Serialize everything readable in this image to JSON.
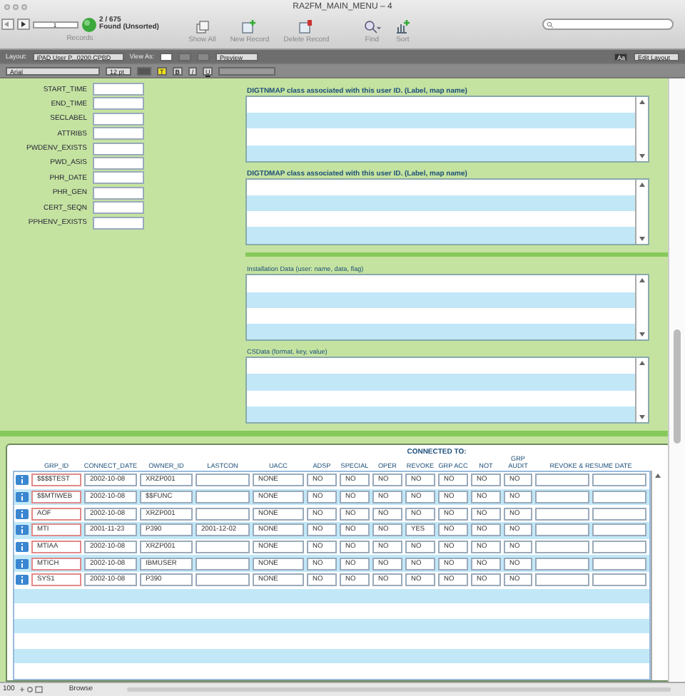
{
  "window": {
    "title": "RA2FM_MAIN_MENU – 4"
  },
  "toolbar": {
    "record": "1",
    "count": "2 / 675",
    "found": "Found (Unsorted)",
    "records_label": "Records",
    "buttons": [
      {
        "kind": "show_all",
        "label": "Show All"
      },
      {
        "kind": "new",
        "label": "New Record"
      },
      {
        "kind": "delete",
        "label": "Delete Record"
      },
      {
        "kind": "find",
        "label": "Find"
      },
      {
        "kind": "sort",
        "label": "Sort"
      }
    ]
  },
  "layout_bar": {
    "layout_label": "Layout:",
    "layout": "iPAD User P...0200.CPBD",
    "view_as": "View As:",
    "preview": "Preview",
    "aa": "Aa",
    "edit_layout": "Edit Layout"
  },
  "format_bar": {
    "font": "Arial",
    "size": "12 pt",
    "highlight": "T",
    "bold": "B",
    "italic": "I",
    "underline": "U"
  },
  "fields": [
    "START_TIME",
    "END_TIME",
    "SECLABEL",
    "ATTRIBS",
    "PWDENV_EXISTS",
    "PWD_ASIS",
    "PHR_DATE",
    "PHR_GEN",
    "CERT_SEQN",
    "PPHENV_EXISTS"
  ],
  "panels": [
    {
      "title": "DIGTNMAP class associated with this user ID. (Label, map name)",
      "bold": true
    },
    {
      "title": "DIGTDMAP class associated with this user ID. (Label, map name)",
      "bold": true,
      "separator_after": true
    },
    {
      "title": "Installation Data (user: name, data, flag)",
      "bold": false
    },
    {
      "title": "CSData (format, key, value)",
      "bold": false
    }
  ],
  "table": {
    "group_header": "CONNECTED TO:",
    "columns": [
      "GRP_ID",
      "CONNECT_DATE",
      "OWNER_ID",
      "LASTCON",
      "UACC",
      "ADSP",
      "SPECIAL",
      "OPER",
      "REVOKE",
      "GRP ACC",
      "NOT",
      "GRP AUDIT",
      "REVOKE & RESUME DATE"
    ],
    "rows": [
      {
        "grp_id": "$$$$TEST",
        "connect_date": "2002-10-08",
        "owner_id": "XRZP001",
        "uacc": "NONE",
        "adsp": "NO",
        "special": "NO",
        "oper": "NO",
        "revoke": "NO",
        "grp_acc": "NO",
        "not": "NO",
        "grp_audit": "NO"
      },
      {
        "grp_id": "$$MTIWEB",
        "connect_date": "2002-10-08",
        "owner_id": "$$FUNC",
        "uacc": "NONE",
        "adsp": "NO",
        "special": "NO",
        "oper": "NO",
        "revoke": "NO",
        "grp_acc": "NO",
        "not": "NO",
        "grp_audit": "NO"
      },
      {
        "grp_id": "AOF",
        "connect_date": "2002-10-08",
        "owner_id": "XRZP001",
        "uacc": "NONE",
        "adsp": "NO",
        "special": "NO",
        "oper": "NO",
        "revoke": "NO",
        "grp_acc": "NO",
        "not": "NO",
        "grp_audit": "NO"
      },
      {
        "grp_id": "MTI",
        "connect_date": "2001-11-23",
        "owner_id": "P390",
        "lastcon": "2001-12-02",
        "uacc": "NONE",
        "adsp": "NO",
        "special": "NO",
        "oper": "NO",
        "revoke": "YES",
        "grp_acc": "NO",
        "not": "NO",
        "grp_audit": "NO"
      },
      {
        "grp_id": "MTIAA",
        "connect_date": "2002-10-08",
        "owner_id": "XRZP001",
        "uacc": "NONE",
        "adsp": "NO",
        "special": "NO",
        "oper": "NO",
        "revoke": "NO",
        "grp_acc": "NO",
        "not": "NO",
        "grp_audit": "NO"
      },
      {
        "grp_id": "MTICH",
        "connect_date": "2002-10-08",
        "owner_id": "IBMUSER",
        "uacc": "NONE",
        "adsp": "NO",
        "special": "NO",
        "oper": "NO",
        "revoke": "NO",
        "grp_acc": "NO",
        "not": "NO",
        "grp_audit": "NO"
      },
      {
        "grp_id": "SYS1",
        "connect_date": "2002-10-08",
        "owner_id": "P390",
        "uacc": "NONE",
        "adsp": "NO",
        "special": "NO",
        "oper": "NO",
        "revoke": "NO",
        "grp_acc": "NO",
        "not": "NO",
        "grp_audit": "NO"
      }
    ]
  },
  "status_bar": {
    "zoom": "100",
    "mode": "Browse"
  }
}
